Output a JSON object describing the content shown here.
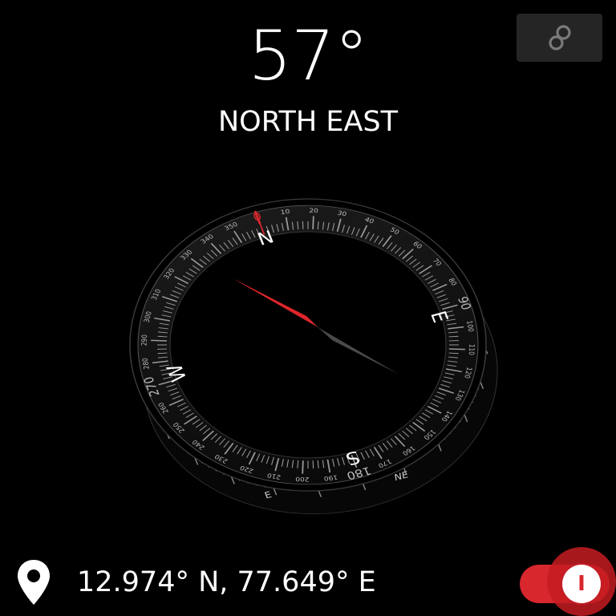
{
  "heading": {
    "degrees": "57°",
    "direction": "NORTH EAST"
  },
  "location": {
    "coordinates": "12.974° N, 77.649° E"
  },
  "toggle": {
    "state": "on",
    "glyph": "I"
  },
  "compass": {
    "cardinals": {
      "north": "N",
      "east": "E",
      "south": "S",
      "west": "W"
    },
    "bezel_labels": {
      "east": "E",
      "north_east": "NE"
    },
    "degree_labels": [
      "0",
      "10",
      "20",
      "30",
      "40",
      "50",
      "60",
      "70",
      "80",
      "90",
      "100",
      "110",
      "120",
      "130",
      "140",
      "150",
      "160",
      "170",
      "180",
      "190",
      "200",
      "210",
      "220",
      "230",
      "240",
      "250",
      "260",
      "270",
      "280",
      "290",
      "300",
      "310",
      "320",
      "330",
      "340",
      "350"
    ],
    "needle_heading": 57
  },
  "colors": {
    "accent": "#d8272d",
    "background": "#000000",
    "needle_north": "#e0252b",
    "needle_south": "#4a4a4a"
  },
  "icons": {
    "link": "link-icon",
    "location": "map-pin-icon"
  }
}
